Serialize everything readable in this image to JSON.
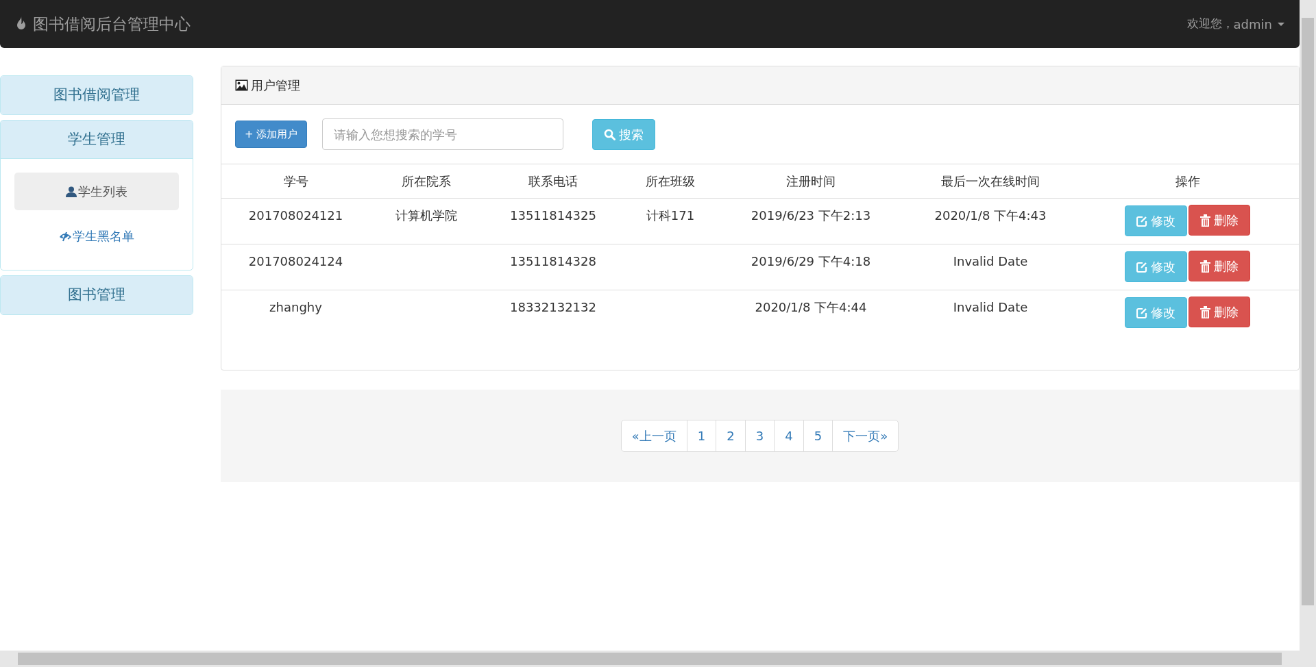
{
  "navbar": {
    "brand": "图书借阅后台管理中心",
    "welcome": "欢迎您，",
    "user": "admin"
  },
  "sidebar": {
    "groups": [
      {
        "label": "图书借阅管理",
        "expanded": false
      },
      {
        "label": "学生管理",
        "expanded": true,
        "items": [
          {
            "label": "学生列表",
            "kind": "user",
            "selected": true
          },
          {
            "label": "学生黑名单",
            "kind": "eye",
            "selected": false
          }
        ]
      },
      {
        "label": "图书管理",
        "expanded": false
      }
    ]
  },
  "panel": {
    "title": "用户管理",
    "add_button": "+ 添加用户",
    "search": {
      "placeholder": "请输入您想搜索的学号"
    },
    "search_button": "搜索"
  },
  "table": {
    "columns": [
      "学号",
      "所在院系",
      "联系电话",
      "所在班级",
      "注册时间",
      "最后一次在线时间",
      "操作"
    ],
    "rows": [
      {
        "cells": [
          "201708024121",
          "计算机学院",
          "13511814325",
          "计科171",
          "2019/6/23 下午2:13",
          "2020/1/8 下午4:43"
        ],
        "edit": "修改",
        "delete": "删除"
      },
      {
        "cells": [
          "201708024124",
          "",
          "13511814328",
          "",
          "2019/6/29 下午4:18",
          "Invalid Date"
        ],
        "edit": "修改",
        "delete": "删除"
      },
      {
        "cells": [
          "zhanghy",
          "",
          "18332132132",
          "",
          "2020/1/8 下午4:44",
          "Invalid Date"
        ],
        "edit": "修改",
        "delete": "删除"
      }
    ]
  },
  "pagination": {
    "prev": "«上一页",
    "pages": [
      "1",
      "2",
      "3",
      "4",
      "5"
    ],
    "next": "下一页»"
  }
}
